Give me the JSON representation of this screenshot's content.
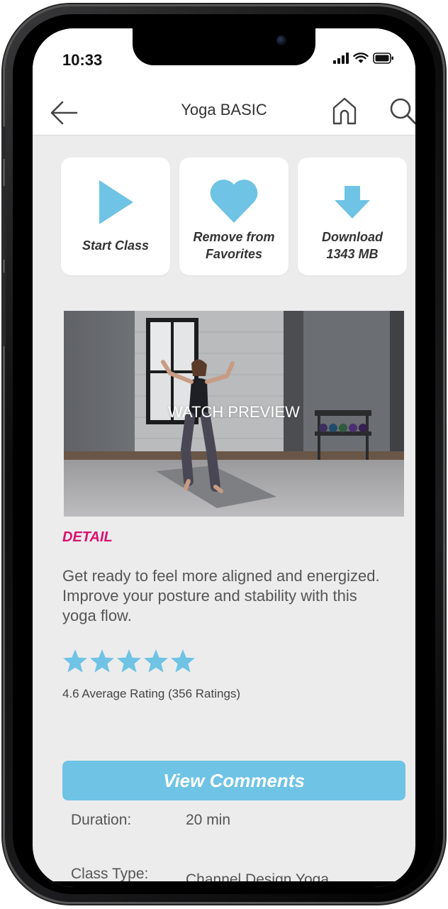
{
  "status_bar": {
    "time": "10:33"
  },
  "nav": {
    "title": "Yoga BASIC"
  },
  "actions": [
    {
      "label": "Start Class",
      "icon": "play-icon"
    },
    {
      "label_line1": "Remove from",
      "label_line2": "Favorites",
      "icon": "heart-icon"
    },
    {
      "label_line1": "Download",
      "label_line2": "1343 MB",
      "icon": "download-arrow-icon"
    }
  ],
  "preview": {
    "label": "WATCH PREVIEW"
  },
  "detail": {
    "heading": "DETAIL",
    "description": "Get ready to feel more aligned and energized.  Improve your posture and stability with this yoga flow.",
    "rating_stars": 5,
    "rating_text": "4.6 Average Rating (356 Ratings)"
  },
  "comments_button": {
    "label": "View Comments"
  },
  "info": [
    {
      "label": "Duration:",
      "value": "20 min"
    },
    {
      "label": "Class Type:",
      "value": "Channel Design Yoga"
    }
  ],
  "colors": {
    "accent_blue": "#6fc3e4",
    "detail_pink": "#d8126f",
    "background": "#ececed"
  }
}
